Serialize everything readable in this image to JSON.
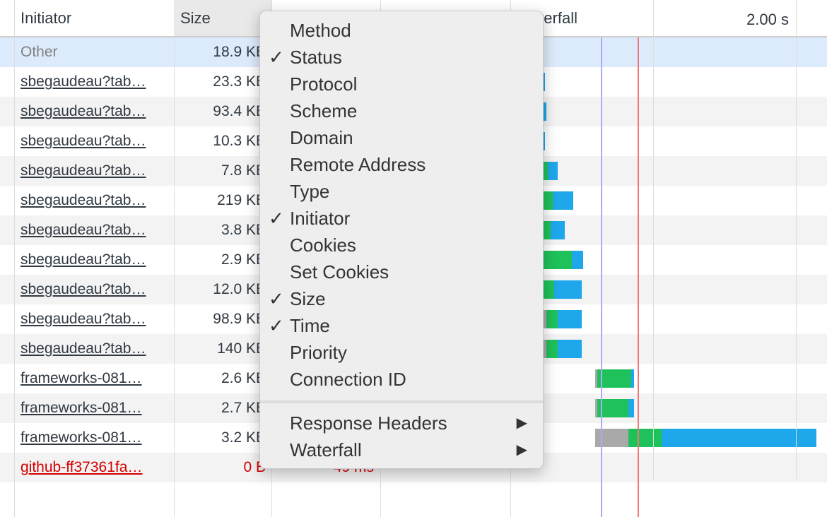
{
  "header": {
    "initiator": "Initiator",
    "size": "Size",
    "waterfall": "Waterfall",
    "tick": "2.00 s"
  },
  "rows": [
    {
      "initiator": "Other",
      "size": "18.9 KB",
      "time": ""
    },
    {
      "initiator": "sbegaudeau?tab…",
      "size": "23.3 KB",
      "time": ""
    },
    {
      "initiator": "sbegaudeau?tab…",
      "size": "93.4 KB",
      "time": ""
    },
    {
      "initiator": "sbegaudeau?tab…",
      "size": "10.3 KB",
      "time": ""
    },
    {
      "initiator": "sbegaudeau?tab…",
      "size": "7.8 KB",
      "time": ""
    },
    {
      "initiator": "sbegaudeau?tab…",
      "size": "219 KB",
      "time": ""
    },
    {
      "initiator": "sbegaudeau?tab…",
      "size": "3.8 KB",
      "time": ""
    },
    {
      "initiator": "sbegaudeau?tab…",
      "size": "2.9 KB",
      "time": ""
    },
    {
      "initiator": "sbegaudeau?tab…",
      "size": "12.0 KB",
      "time": ""
    },
    {
      "initiator": "sbegaudeau?tab…",
      "size": "98.9 KB",
      "time": ""
    },
    {
      "initiator": "sbegaudeau?tab…",
      "size": "140 KB",
      "time": ""
    },
    {
      "initiator": "frameworks-081…",
      "size": "2.6 KB",
      "time": ""
    },
    {
      "initiator": "frameworks-081…",
      "size": "2.7 KB",
      "time": ""
    },
    {
      "initiator": "frameworks-081…",
      "size": "3.2 KB",
      "time": ""
    },
    {
      "initiator": "github-ff37361fa…",
      "size": "0 B",
      "time": "49 ms"
    }
  ],
  "menu": {
    "items": [
      {
        "label": "Method",
        "checked": false
      },
      {
        "label": "Status",
        "checked": true
      },
      {
        "label": "Protocol",
        "checked": false
      },
      {
        "label": "Scheme",
        "checked": false
      },
      {
        "label": "Domain",
        "checked": false
      },
      {
        "label": "Remote Address",
        "checked": false
      },
      {
        "label": "Type",
        "checked": false
      },
      {
        "label": "Initiator",
        "checked": true
      },
      {
        "label": "Cookies",
        "checked": false
      },
      {
        "label": "Set Cookies",
        "checked": false
      },
      {
        "label": "Size",
        "checked": true
      },
      {
        "label": "Time",
        "checked": true
      },
      {
        "label": "Priority",
        "checked": false
      },
      {
        "label": "Connection ID",
        "checked": false
      }
    ],
    "submenus": [
      {
        "label": "Response Headers"
      },
      {
        "label": "Waterfall"
      }
    ],
    "check": "✓",
    "arrow": "▶"
  },
  "colors": {
    "error": "#d50000",
    "selected": "#dcebfb",
    "green": "#1fc15a",
    "blue": "#1ea7ea"
  }
}
